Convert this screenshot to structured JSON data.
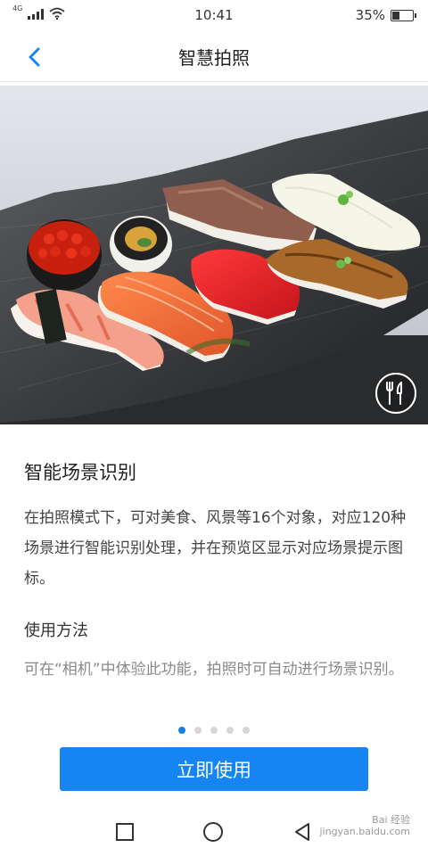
{
  "status_bar": {
    "network": "4G",
    "time": "10:41",
    "battery_percent_text": "35%",
    "battery_level": 0.35
  },
  "nav": {
    "back_icon": "chevron-left-icon",
    "title": "智慧拍照"
  },
  "hero": {
    "subject": "sushi-platter",
    "badge_icon": "fork-knife-icon"
  },
  "content": {
    "title": "智能场景识别",
    "body": "在拍照模式下，可对美食、风景等16个对象，对应120种场景进行智能识别处理，并在预览区显示对应场景提示图标。",
    "usage_title": "使用方法",
    "usage_body": "可在“相机”中体验此功能，拍照时可自动进行场景识别。"
  },
  "pagination": {
    "count": 5,
    "active_index": 0
  },
  "primary_button": {
    "label": "立即使用"
  },
  "system_nav": {
    "recents_icon": "square-icon",
    "home_icon": "circle-icon",
    "back_icon": "triangle-back-icon"
  },
  "watermark": {
    "text": "Bai 经验",
    "url": "jingyan.baidu.com"
  },
  "colors": {
    "accent": "#1685f2",
    "active_dot": "#1a7fe8"
  }
}
